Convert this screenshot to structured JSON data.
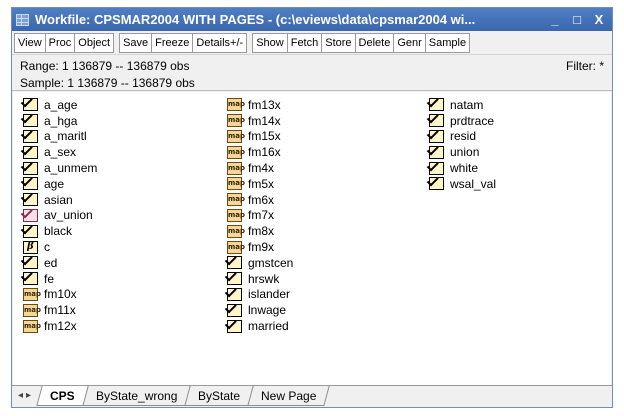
{
  "window": {
    "title": "Workfile: CPSMAR2004 WITH PAGES - (c:\\eviews\\data\\cpsmar2004 wi...",
    "controls": [
      "_",
      "□",
      "X"
    ]
  },
  "toolbar": {
    "groups": [
      [
        "View",
        "Proc",
        "Object"
      ],
      [
        "Save",
        "Freeze",
        "Details+/-"
      ],
      [
        "Show",
        "Fetch",
        "Store",
        "Delete",
        "Genr",
        "Sample"
      ]
    ]
  },
  "info": {
    "range": "Range:  1 136879  --  136879 obs",
    "sample": "Sample: 1 136879  --  136879 obs",
    "filter": "Filter: *"
  },
  "objects": {
    "col1": [
      {
        "name": "a_age",
        "icon": "series"
      },
      {
        "name": "a_hga",
        "icon": "series"
      },
      {
        "name": "a_maritl",
        "icon": "series"
      },
      {
        "name": "a_sex",
        "icon": "series"
      },
      {
        "name": "a_unmem",
        "icon": "series"
      },
      {
        "name": "age",
        "icon": "series"
      },
      {
        "name": "asian",
        "icon": "series"
      },
      {
        "name": "av_union",
        "icon": "series-pink"
      },
      {
        "name": "black",
        "icon": "series"
      },
      {
        "name": "c",
        "icon": "coef"
      },
      {
        "name": "ed",
        "icon": "series"
      },
      {
        "name": "fe",
        "icon": "series"
      },
      {
        "name": "fm10x",
        "icon": "map"
      },
      {
        "name": "fm11x",
        "icon": "map"
      },
      {
        "name": "fm12x",
        "icon": "map"
      }
    ],
    "col2": [
      {
        "name": "fm13x",
        "icon": "map"
      },
      {
        "name": "fm14x",
        "icon": "map"
      },
      {
        "name": "fm15x",
        "icon": "map"
      },
      {
        "name": "fm16x",
        "icon": "map"
      },
      {
        "name": "fm4x",
        "icon": "map"
      },
      {
        "name": "fm5x",
        "icon": "map"
      },
      {
        "name": "fm6x",
        "icon": "map"
      },
      {
        "name": "fm7x",
        "icon": "map"
      },
      {
        "name": "fm8x",
        "icon": "map"
      },
      {
        "name": "fm9x",
        "icon": "map"
      },
      {
        "name": "gmstcen",
        "icon": "series"
      },
      {
        "name": "hrswk",
        "icon": "series"
      },
      {
        "name": "islander",
        "icon": "series"
      },
      {
        "name": "lnwage",
        "icon": "series"
      },
      {
        "name": "married",
        "icon": "series"
      }
    ],
    "col3": [
      {
        "name": "natam",
        "icon": "series"
      },
      {
        "name": "prdtrace",
        "icon": "series"
      },
      {
        "name": "resid",
        "icon": "series"
      },
      {
        "name": "union",
        "icon": "series"
      },
      {
        "name": "white",
        "icon": "series"
      },
      {
        "name": "wsal_val",
        "icon": "series"
      }
    ]
  },
  "icon_glyphs": {
    "map": "map",
    "coef": "β"
  },
  "tabs": {
    "arrows": "◂▸",
    "items": [
      {
        "label": "CPS",
        "active": true
      },
      {
        "label": "ByState_wrong",
        "active": false
      },
      {
        "label": "ByState",
        "active": false
      },
      {
        "label": "New Page",
        "active": false
      }
    ]
  }
}
